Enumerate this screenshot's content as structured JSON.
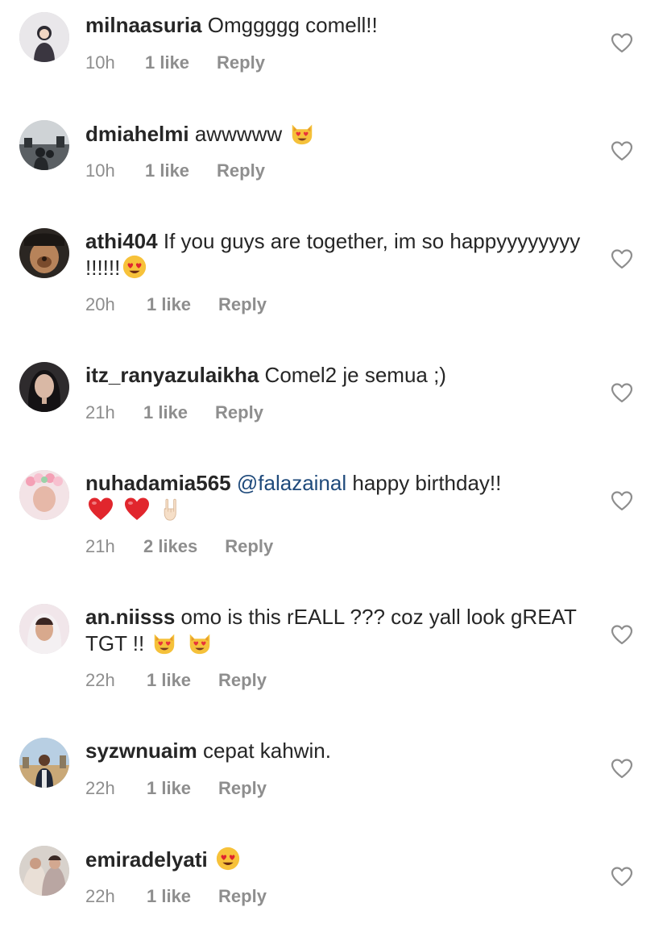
{
  "comments": [
    {
      "username": "milnaasuria",
      "text": "Omggggg comell!!",
      "time": "10h",
      "likes": "1 like",
      "reply": "Reply",
      "avatar_icon": "profile-photo",
      "emoji": []
    },
    {
      "username": "dmiahelmi",
      "text": "awwwww",
      "time": "10h",
      "likes": "1 like",
      "reply": "Reply",
      "avatar_icon": "profile-photo",
      "emoji": [
        "heart-eyes-cat"
      ]
    },
    {
      "username": "athi404",
      "text": "If you guys are together, im so happyyyyyyyy !!!!!!",
      "time": "20h",
      "likes": "1 like",
      "reply": "Reply",
      "avatar_icon": "profile-photo",
      "emoji": [
        "heart-eyes-face"
      ]
    },
    {
      "username": "itz_ranyazulaikha",
      "text": "Comel2 je semua ;)",
      "time": "21h",
      "likes": "1 like",
      "reply": "Reply",
      "avatar_icon": "profile-photo",
      "emoji": []
    },
    {
      "username": "nuhadamia565",
      "mention": "@falazainal",
      "text": "happy birthday!!",
      "time": "21h",
      "likes": "2 likes",
      "reply": "Reply",
      "avatar_icon": "profile-photo",
      "emoji": [
        "red-heart",
        "red-heart",
        "sign-of-horns-hand"
      ]
    },
    {
      "username": "an.niisss",
      "text": "omo is this rEALL ??? coz yall look gREAT TGT !!",
      "time": "22h",
      "likes": "1 like",
      "reply": "Reply",
      "avatar_icon": "profile-photo",
      "emoji": [
        "heart-eyes-cat",
        "heart-eyes-cat"
      ]
    },
    {
      "username": "syzwnuaim",
      "text": "cepat kahwin.",
      "time": "22h",
      "likes": "1 like",
      "reply": "Reply",
      "avatar_icon": "profile-photo",
      "emoji": []
    },
    {
      "username": "emiradelyati",
      "text": "",
      "time": "22h",
      "likes": "1 like",
      "reply": "Reply",
      "avatar_icon": "profile-photo",
      "emoji": [
        "heart-eyes-face"
      ]
    }
  ],
  "colors": {
    "text": "#262626",
    "meta": "#8e8e8e",
    "mention": "#1f4a7b",
    "heart_outline": "#8e8e8e"
  }
}
